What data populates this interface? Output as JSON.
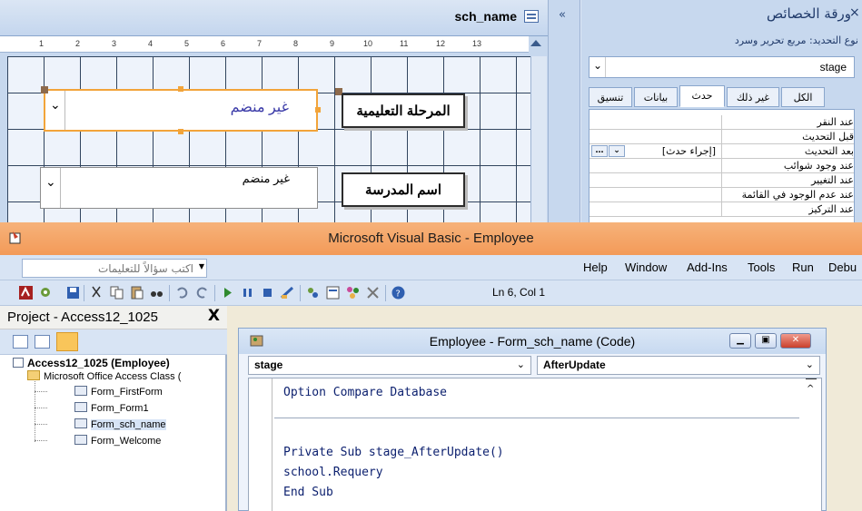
{
  "designer": {
    "tab_title": "sch_name",
    "collapse_glyph": "«",
    "ruler_numbers": [
      "1",
      "2",
      "3",
      "4",
      "5",
      "6",
      "7",
      "8",
      "9",
      "10",
      "11",
      "12",
      "13"
    ],
    "combo_stage_text": "غير منضم",
    "combo_school_text": "غير منضم",
    "label_stage": "المرحلة التعليمية",
    "label_school": "اسم المدرسة"
  },
  "property_sheet": {
    "title": "ورقة الخصائص",
    "close_glyph": "×",
    "selection_type": "نوع التحديد: مربع تحرير وسرد",
    "selected_object": "stage",
    "tabs": [
      "تنسيق",
      "بيانات",
      "حدث",
      "غير ذلك",
      "الكل"
    ],
    "active_tab": "حدث",
    "rows": [
      {
        "name": "عند النقر",
        "value": ""
      },
      {
        "name": "قبل التحديث",
        "value": ""
      },
      {
        "name": "بعد التحديث",
        "value": "[إجراء حدث]"
      },
      {
        "name": "عند وجود شوائب",
        "value": ""
      },
      {
        "name": "عند التغيير",
        "value": ""
      },
      {
        "name": "عند عدم الوجود في القائمة",
        "value": ""
      },
      {
        "name": "عند التركيز",
        "value": ""
      }
    ],
    "builder_glyph": "…",
    "dropdown_glyph": "⌄"
  },
  "vbe": {
    "title": "Microsoft Visual Basic - Employee",
    "help_placeholder": "اكتب سؤالاً للتعليمات",
    "menu": [
      "Help",
      "Window",
      "Add-Ins",
      "Tools",
      "Run",
      "Debu"
    ],
    "status_position": "Ln 6, Col 1",
    "project": {
      "title": "Project - Access12_1025",
      "close_glyph": "X",
      "root": "Access12_1025 (Employee)",
      "folder": "Microsoft Office Access Class (",
      "items": [
        "Form_FirstForm",
        "Form_Form1",
        "Form_sch_name",
        "Form_Welcome"
      ],
      "selected_item": "Form_sch_name"
    },
    "code_window": {
      "title": "Employee - Form_sch_name (Code)",
      "object_combo": "stage",
      "procedure_combo": "AfterUpdate",
      "lines": [
        "Option Compare Database",
        "Private Sub stage_AfterUpdate()",
        "school.Requery",
        "End Sub"
      ]
    }
  }
}
